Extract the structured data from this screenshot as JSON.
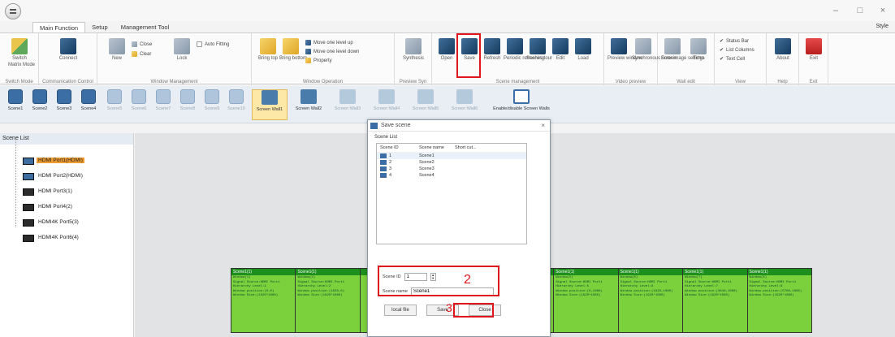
{
  "title_bar": {
    "controls": {
      "minimize": "–",
      "maximize": "□",
      "close": "×"
    }
  },
  "menu": {
    "tabs": [
      {
        "label": "Main Function",
        "active": true
      },
      {
        "label": "Setup",
        "active": false
      },
      {
        "label": "Management Tool",
        "active": false
      }
    ],
    "style_label": "Style"
  },
  "ribbon": {
    "groups": [
      {
        "label": "Switch Mode",
        "buttons": [
          "Switch",
          "Matrix Mode"
        ]
      },
      {
        "label": "Communication Control",
        "buttons": [
          "Connect"
        ]
      },
      {
        "label": "Window Management",
        "buttons": [
          "New",
          "Close",
          "Clear",
          "Lock",
          "Auto Fitting"
        ]
      },
      {
        "label": "Window Operation",
        "buttons": [
          "Bring top",
          "Bring bottom",
          "Move one level up",
          "Move one level down",
          "Property"
        ]
      },
      {
        "label": "Preview Syn",
        "buttons": [
          "Synthesis"
        ]
      },
      {
        "label": "Scene management",
        "buttons": [
          "Open",
          "Save",
          "Refresh",
          "Periodic refreshing",
          "Scenes tour",
          "Edit",
          "Load"
        ]
      },
      {
        "label": "Video preview",
        "buttons": [
          "Preview window",
          "Synchronous screen"
        ]
      },
      {
        "label": "Wall edit",
        "buttons": [
          "Error image settings",
          "Echo"
        ]
      },
      {
        "label": "View",
        "buttons": [
          "Status Bar",
          "List Columns",
          "Text Cell"
        ]
      },
      {
        "label": "Help",
        "buttons": [
          "About"
        ]
      },
      {
        "label": "Exit",
        "buttons": [
          "Exit"
        ]
      }
    ]
  },
  "scene_toolbar": {
    "scenes": [
      {
        "label": "Scene1",
        "faded": false
      },
      {
        "label": "Scene2",
        "faded": false
      },
      {
        "label": "Scene3",
        "faded": false
      },
      {
        "label": "Scene4",
        "faded": false
      },
      {
        "label": "Scene5",
        "faded": true
      },
      {
        "label": "Scene6",
        "faded": true
      },
      {
        "label": "Scene7",
        "faded": true
      },
      {
        "label": "Scene8",
        "faded": true
      },
      {
        "label": "Scene9",
        "faded": true
      },
      {
        "label": "Scene10",
        "faded": true
      }
    ],
    "walls": [
      {
        "label": "Screen Wall1",
        "active": true,
        "faded": false
      },
      {
        "label": "Screen Wall2",
        "active": false,
        "faded": false
      },
      {
        "label": "Screen Wall3",
        "active": false,
        "faded": true
      },
      {
        "label": "Screen Wall4",
        "active": false,
        "faded": true
      },
      {
        "label": "Screen Wall5",
        "active": false,
        "faded": true
      },
      {
        "label": "Screen Wall6",
        "active": false,
        "faded": true
      },
      {
        "label": "Enable/disable Screen Walls",
        "active": false,
        "faded": false
      }
    ]
  },
  "scene_list_panel": {
    "title": "Scene List",
    "items": [
      {
        "label": "HDMI Port1(HDMI)",
        "selected": true,
        "type": "hdmi"
      },
      {
        "label": "HDMI Port2(HDMI)",
        "selected": false,
        "type": "hdmi"
      },
      {
        "label": "HDMI Port3(1)",
        "selected": false,
        "type": "dark"
      },
      {
        "label": "HDMI Port4(2)",
        "selected": false,
        "type": "dark"
      },
      {
        "label": "HDMI4K Port5(3)",
        "selected": false,
        "type": "dark"
      },
      {
        "label": "HDMI4K Port6(4)",
        "selected": false,
        "type": "dark"
      }
    ]
  },
  "wall_cells": [
    {
      "title": "Scene1(1)",
      "lines": [
        "Window(1)",
        "Signal Source:HDMI Port1",
        "Hierarchy Level:1",
        "Window position:(0,0)",
        "Window Size:(1920*1080)"
      ]
    },
    {
      "title": "Scene1(1)",
      "lines": [
        "Window(2)",
        "Signal Source:HDMI Port1",
        "Hierarchy Level:2",
        "Window position:(1920,0)",
        "Window Size:(1920*1080)"
      ]
    },
    {
      "title": "",
      "lines": []
    },
    {
      "title": "",
      "lines": []
    },
    {
      "title": "",
      "lines": []
    },
    {
      "title": "Scene1(1)",
      "lines": [
        "Window(5)",
        "Signal Source:HDMI Port1",
        "Hierarchy Level:5",
        "Window position:(0,1080)",
        "Window Size:(1920*1080)"
      ]
    },
    {
      "title": "Scene1(1)",
      "lines": [
        "Window(6)",
        "Signal Source:HDMI Port1",
        "Hierarchy Level:6",
        "Window position:(1920,1080)",
        "Window Size:(1920*1080)"
      ]
    },
    {
      "title": "Scene1(1)",
      "lines": [
        "Window(7)",
        "Signal Source:HDMI Port1",
        "Hierarchy Level:7",
        "Window position:(3840,1080)",
        "Window Size:(1920*1080)"
      ]
    },
    {
      "title": "Scene1(1)",
      "lines": [
        "Window(8)",
        "Signal Source:HDMI Port1",
        "Hierarchy Level:8",
        "Window position:(5760,1080)",
        "Window Size:(1920*1080)"
      ]
    }
  ],
  "save_dialog": {
    "title": "Save scene",
    "close_glyph": "×",
    "section_label": "Scene List",
    "columns": [
      "Scene ID",
      "Scene name",
      "Short cut..."
    ],
    "rows": [
      {
        "id": "1",
        "name": "Scene1",
        "selected": true
      },
      {
        "id": "2",
        "name": "Scene2",
        "selected": false
      },
      {
        "id": "3",
        "name": "Scene3",
        "selected": false
      },
      {
        "id": "4",
        "name": "Scene4",
        "selected": false
      }
    ],
    "scene_id_label": "Scene ID",
    "scene_id_value": "1",
    "scene_name_label": "Scene name",
    "scene_name_value": "Scene1",
    "buttons": {
      "local_file": "local file",
      "save": "Save",
      "close": "Close"
    }
  },
  "annotations": {
    "step2": "2",
    "step3": "3"
  },
  "colors": {
    "highlight": "#e0161d",
    "selected_item": "#ef9c2f",
    "wall_cell": "#7ad13c"
  }
}
